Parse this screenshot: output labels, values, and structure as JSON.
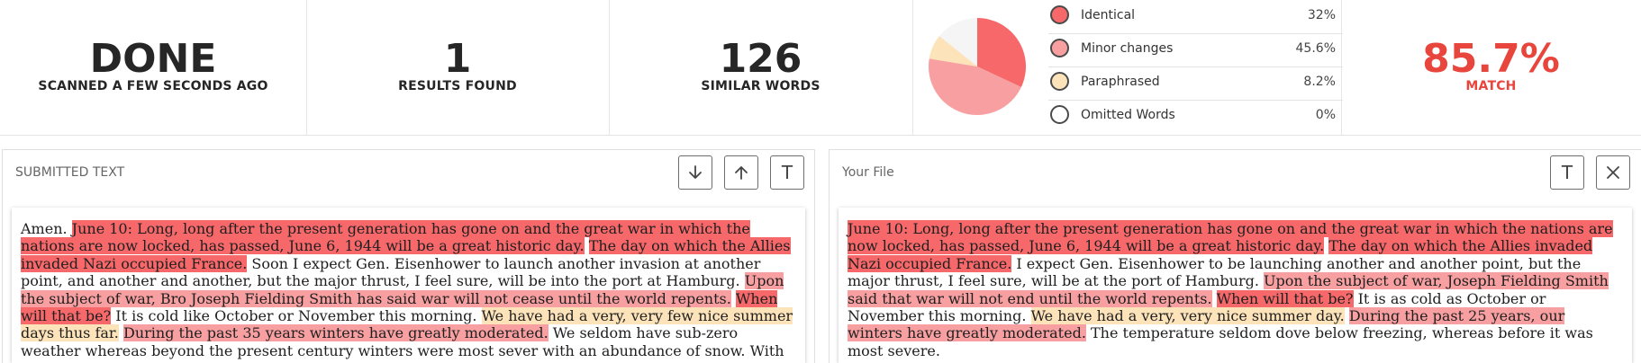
{
  "stats": {
    "status": {
      "value": "DONE",
      "label": "SCANNED A FEW SECONDS AGO"
    },
    "results": {
      "value": "1",
      "label": "RESULTS FOUND"
    },
    "similar_words": {
      "value": "126",
      "label": "SIMILAR WORDS"
    },
    "match": {
      "value": "85.7%",
      "label": "MATCH"
    }
  },
  "legend": [
    {
      "label": "Identical",
      "value": "32%",
      "color": "#f6686a"
    },
    {
      "label": "Minor changes",
      "value": "45.6%",
      "color": "#f8a0a1"
    },
    {
      "label": "Paraphrased",
      "value": "8.2%",
      "color": "#fde3ba"
    },
    {
      "label": "Omitted Words",
      "value": "0%",
      "color": "#ffffff"
    }
  ],
  "chart_data": {
    "type": "pie",
    "categories": [
      "Identical",
      "Minor changes",
      "Paraphrased",
      "Omitted Words"
    ],
    "values": [
      32,
      45.6,
      8.2,
      0
    ],
    "colors": [
      "#f6686a",
      "#f8a0a1",
      "#fde3ba",
      "#ffffff"
    ],
    "remainder_color": "#f5f5f6",
    "legend_position": "right"
  },
  "left_panel": {
    "title": "SUBMITTED TEXT",
    "buttons": {
      "down": "↓",
      "up": "↑",
      "text": "T"
    },
    "segments": [
      {
        "t": "Amen. ",
        "c": "none"
      },
      {
        "t": "June 10: Long, long after the present generation has gone on and the great war in which the nations are now locked, has passed, June 6, 1944 will be a great historic day.",
        "c": "identical"
      },
      {
        "t": " ",
        "c": "none"
      },
      {
        "t": "The day on which the Allies invaded Nazi occupied France.",
        "c": "identical"
      },
      {
        "t": " Soon I expect Gen. Eisenhower to launch another invasion at another point, and another and another, but the major thrust, I feel sure, will be into the port at Hamburg. ",
        "c": "none"
      },
      {
        "t": "Upon the subject of war, Bro Joseph Fielding Smith has said war will not cease until the world repents.",
        "c": "minor"
      },
      {
        "t": " ",
        "c": "none"
      },
      {
        "t": "When will that be?",
        "c": "identical"
      },
      {
        "t": " It is cold like October or November this morning. ",
        "c": "none"
      },
      {
        "t": "We have had a very, very few nice summer days thus far.",
        "c": "para"
      },
      {
        "t": " ",
        "c": "none"
      },
      {
        "t": "During the past 35 years winters have greatly moderated.",
        "c": "minor"
      },
      {
        "t": " We seldom have sub-zero weather whereas beyond the present century winters were most sever with an abundance of snow. With",
        "c": "none"
      }
    ]
  },
  "right_panel": {
    "title": "Your File",
    "buttons": {
      "text": "T",
      "close": "✕"
    },
    "segments": [
      {
        "t": "June 10: Long, long after the present generation has gone on and the great war in which the nations are now locked, has passed, June 6, 1944 will be a great historic day.",
        "c": "identical"
      },
      {
        "t": " ",
        "c": "none"
      },
      {
        "t": "The day on which the Allies invaded Nazi occupied France.",
        "c": "identical"
      },
      {
        "t": " I expect Gen. Eisenhower to be launching another and another point, but the major thrust, I feel sure, will be at the port of Hamburg. ",
        "c": "none"
      },
      {
        "t": "Upon the subject of war, Joseph Fielding Smith said that war will not end until the world repents.",
        "c": "minor"
      },
      {
        "t": " ",
        "c": "none"
      },
      {
        "t": "When will that be?",
        "c": "identical"
      },
      {
        "t": " It is as cold as October or November this morning. ",
        "c": "none"
      },
      {
        "t": "We have had a very, very nice summer day.",
        "c": "para"
      },
      {
        "t": " ",
        "c": "none"
      },
      {
        "t": "During the past 25 years, our winters have greatly moderated.",
        "c": "minor"
      },
      {
        "t": " The temperature seldom dove below freezing, whereas before it was most severe.",
        "c": "none"
      }
    ]
  }
}
